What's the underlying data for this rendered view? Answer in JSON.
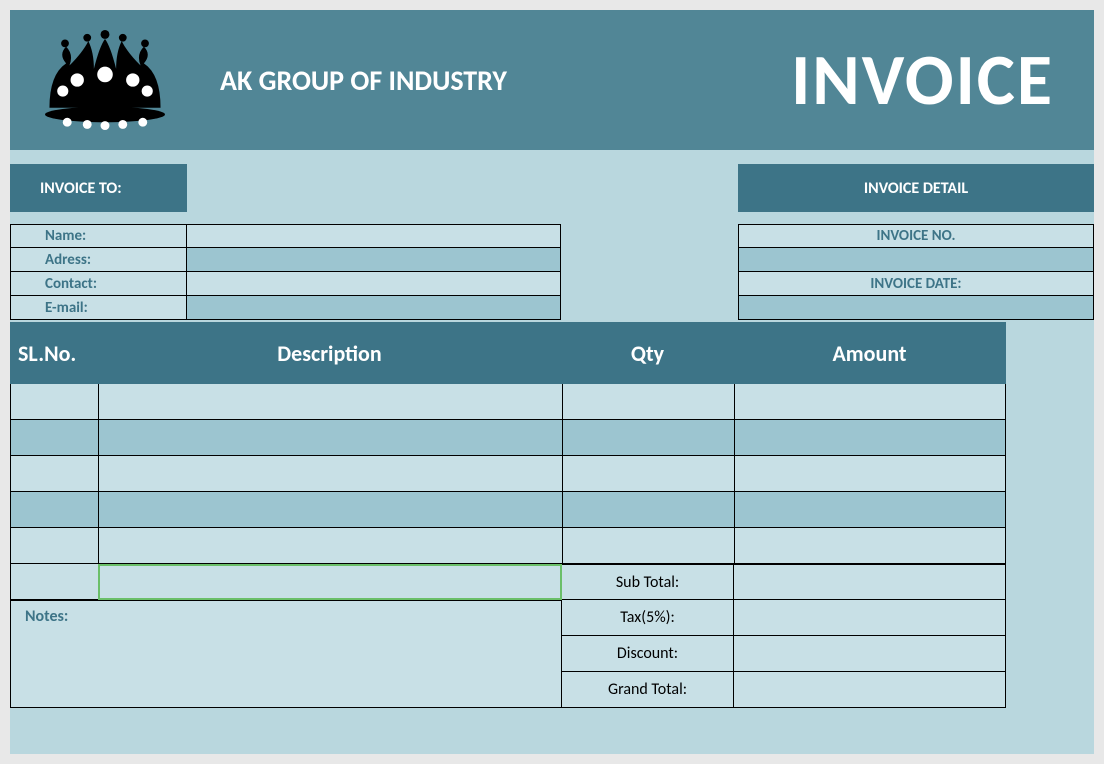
{
  "header": {
    "company": "AK GROUP OF INDUSTRY",
    "title": "INVOICE"
  },
  "invoice_to": {
    "label": "INVOICE TO:",
    "fields": {
      "name_label": "Name:",
      "name_value": "",
      "address_label": "Adress:",
      "address_value": "",
      "contact_label": "Contact:",
      "contact_value": "",
      "email_label": "E-mail:",
      "email_value": ""
    }
  },
  "invoice_detail": {
    "label": "INVOICE DETAIL",
    "invoice_no_label": "INVOICE NO.",
    "invoice_no_value": "",
    "invoice_date_label": "INVOICE DATE:",
    "invoice_date_value": ""
  },
  "table": {
    "headers": {
      "sl": "SL.No.",
      "desc": "Description",
      "qty": "Qty",
      "amt": "Amount"
    },
    "rows": [
      {
        "sl": "",
        "desc": "",
        "qty": "",
        "amt": ""
      },
      {
        "sl": "",
        "desc": "",
        "qty": "",
        "amt": ""
      },
      {
        "sl": "",
        "desc": "",
        "qty": "",
        "amt": ""
      },
      {
        "sl": "",
        "desc": "",
        "qty": "",
        "amt": ""
      },
      {
        "sl": "",
        "desc": "",
        "qty": "",
        "amt": ""
      }
    ]
  },
  "summary": {
    "subtotal_label": "Sub Total:",
    "subtotal_value": "",
    "tax_label": "Tax(5%):",
    "tax_value": "",
    "discount_label": "Discount:",
    "discount_value": "",
    "grand_label": "Grand Total:",
    "grand_value": ""
  },
  "notes": {
    "label": "Notes:",
    "value": ""
  }
}
